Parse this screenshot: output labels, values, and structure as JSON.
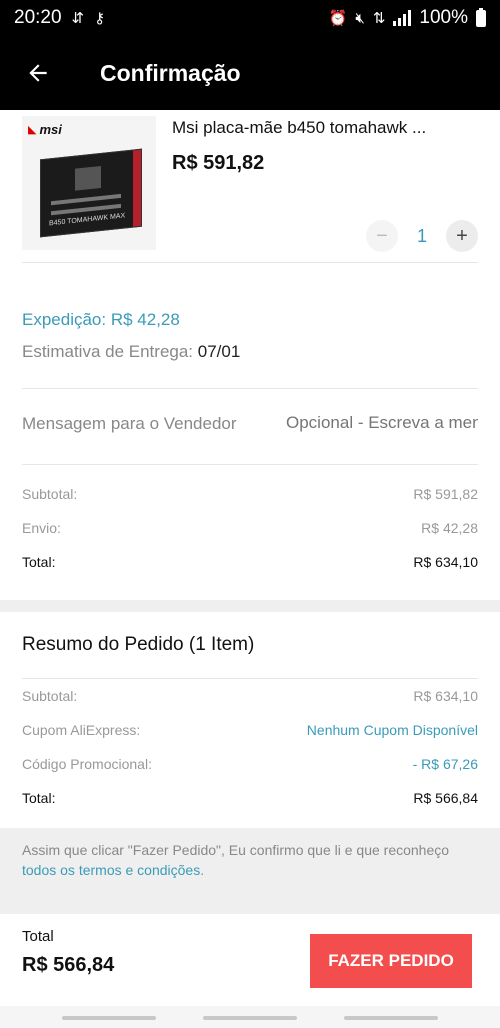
{
  "status_bar": {
    "time": "20:20",
    "battery": "100%",
    "icons": [
      "sync-icon",
      "key-icon",
      "alarm-icon",
      "mute-icon",
      "data-icon",
      "signal-icon",
      "battery-icon"
    ]
  },
  "header": {
    "title": "Confirmação",
    "back_icon": "arrow-left-icon"
  },
  "product": {
    "brand_logo": "msi",
    "image_label": "B450 TOMAHAWK MAX",
    "title": "Msi placa-mãe b450 tomahawk ...",
    "price": "R$ 591,82",
    "quantity": "1",
    "minus": "−",
    "plus": "+"
  },
  "shipping": {
    "label": "Expedição: R$ 42,28",
    "delivery_label": "Estimativa de Entrega:",
    "delivery_date": "07/01"
  },
  "message": {
    "label": "Mensagem para o Vendedor",
    "placeholder": "Opcional - Escreva a mensagem"
  },
  "store_totals": [
    {
      "label": "Subtotal:",
      "value": "R$ 591,82"
    },
    {
      "label": "Envio:",
      "value": "R$ 42,28"
    },
    {
      "label": "Total:",
      "value": "R$ 634,10"
    }
  ],
  "summary": {
    "title": "Resumo do Pedido (1 Item)",
    "rows": [
      {
        "label": "Subtotal:",
        "value": "R$ 634,10"
      },
      {
        "label": "Cupom AliExpress:",
        "value": "Nenhum Cupom Disponível"
      },
      {
        "label": "Código Promocional:",
        "value": "- R$ 67,26"
      },
      {
        "label": "Total:",
        "value": "R$ 566,84"
      }
    ]
  },
  "terms": {
    "text": "Assim que clicar \"Fazer Pedido\", Eu confirmo que li e que reconheço ",
    "link": "todos os termos e condições",
    "end": "."
  },
  "footer": {
    "total_label": "Total",
    "total_value": "R$ 566,84",
    "button_label": "FAZER PEDIDO"
  },
  "colors": {
    "accent": "#3a9bb8",
    "button": "#f34d4d",
    "header_bg": "#000000"
  }
}
